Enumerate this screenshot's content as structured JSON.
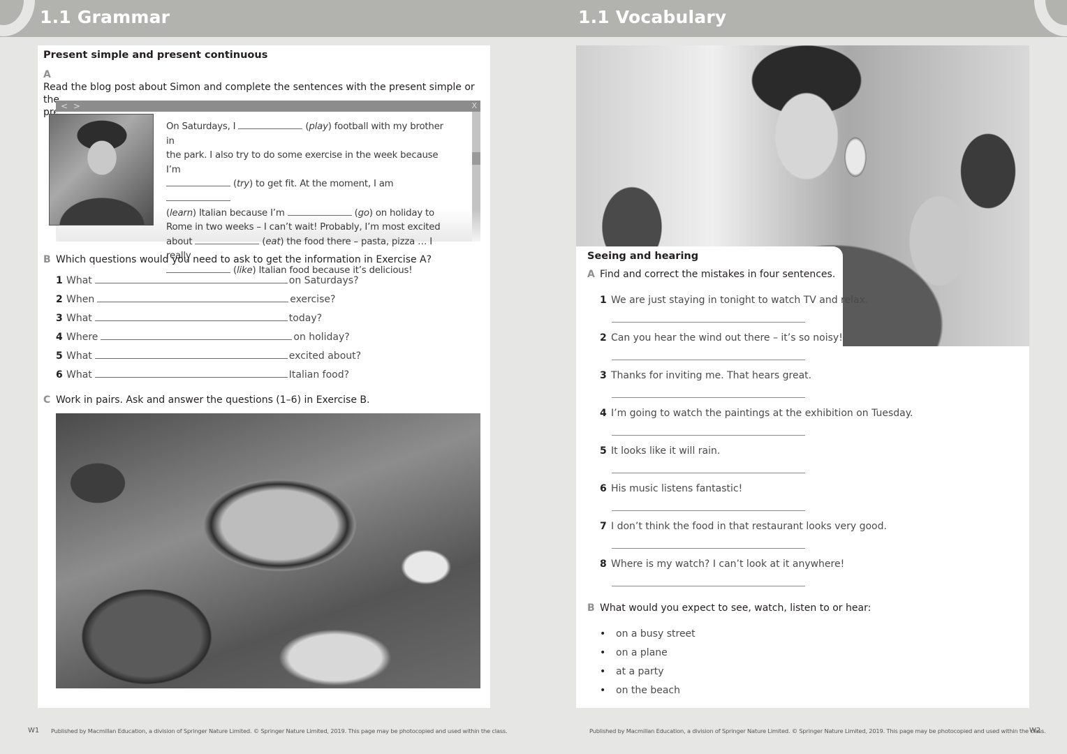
{
  "left_page": {
    "header_title": "1.1 Grammar",
    "section_title": "Present simple and present continuous",
    "exercise_a": {
      "letter": "A",
      "instruction_line1": "Read the blog post about Simon and complete the sentences with the present simple or the",
      "instruction_line2": "present continuous verb forms.",
      "blog": {
        "nav_icon": "back-forward-arrows",
        "nav_text": "< >",
        "close_text": "X",
        "lines": [
          {
            "before": "On Saturdays, I ",
            "hint": "play",
            "after": " football with my brother in"
          },
          {
            "text": "the park. I also try to do some exercise in the week because I’m"
          },
          {
            "hint": "try",
            "after": " to get fit. At the moment, I am "
          },
          {
            "hint": "learn",
            "after": " Italian because I’m ",
            "hint2": "go",
            "after2": " on holiday to"
          },
          {
            "text": "Rome in two weeks – I can’t wait! Probably, I’m most excited"
          },
          {
            "before": "about ",
            "hint": "eat",
            "after": " the food there – pasta, pizza … I really"
          },
          {
            "hint": "like",
            "after": " Italian food because it’s delicious!"
          }
        ]
      }
    },
    "exercise_b": {
      "letter": "B",
      "instruction": "Which questions would you need to ask to get the information in Exercise A?",
      "questions": [
        {
          "num": "1",
          "start": "What",
          "end": "on Saturdays?"
        },
        {
          "num": "2",
          "start": "When",
          "end": "exercise?"
        },
        {
          "num": "3",
          "start": "What",
          "end": "today?"
        },
        {
          "num": "4",
          "start": "Where",
          "end": "on holiday?"
        },
        {
          "num": "5",
          "start": "What",
          "end": "excited about?"
        },
        {
          "num": "6",
          "start": "What",
          "end": "Italian food?"
        }
      ]
    },
    "exercise_c": {
      "letter": "C",
      "instruction": "Work in pairs. Ask and answer the questions (1–6) in Exercise B."
    },
    "footer": {
      "page_number": "W1",
      "copyright": "Published by Macmillan Education, a division of Springer Nature Limited. © Springer Nature Limited, 2019. This page may be photocopied and used within the class."
    }
  },
  "right_page": {
    "header_title": "1.1 Vocabulary",
    "section_title": "Seeing and hearing",
    "exercise_a": {
      "letter": "A",
      "instruction": "Find and correct the mistakes in four sentences.",
      "sentences": [
        {
          "num": "1",
          "text": "We are just staying in tonight to watch TV and relax."
        },
        {
          "num": "2",
          "text": "Can you hear the wind out there – it’s so noisy!"
        },
        {
          "num": "3",
          "text": "Thanks for inviting me. That hears great."
        },
        {
          "num": "4",
          "text": "I’m going to watch the paintings at the exhibition on Tuesday."
        },
        {
          "num": "5",
          "text": "It looks like it will rain."
        },
        {
          "num": "6",
          "text": "His music listens fantastic!"
        },
        {
          "num": "7",
          "text": "I don’t think the food in that restaurant looks very good."
        },
        {
          "num": "8",
          "text": "Where is my watch? I can’t look at it anywhere!"
        }
      ]
    },
    "exercise_b": {
      "letter": "B",
      "instruction": "What would you expect to see, watch, listen to or hear:",
      "bullet_glyph": "•",
      "items": [
        "on a busy street",
        "on a plane",
        "at a party",
        "on the beach"
      ]
    },
    "footer": {
      "page_number": "W2",
      "copyright": "Published by Macmillan Education, a division of Springer Nature Limited. © Springer Nature Limited, 2019. This page may be photocopied and used within the class."
    }
  }
}
